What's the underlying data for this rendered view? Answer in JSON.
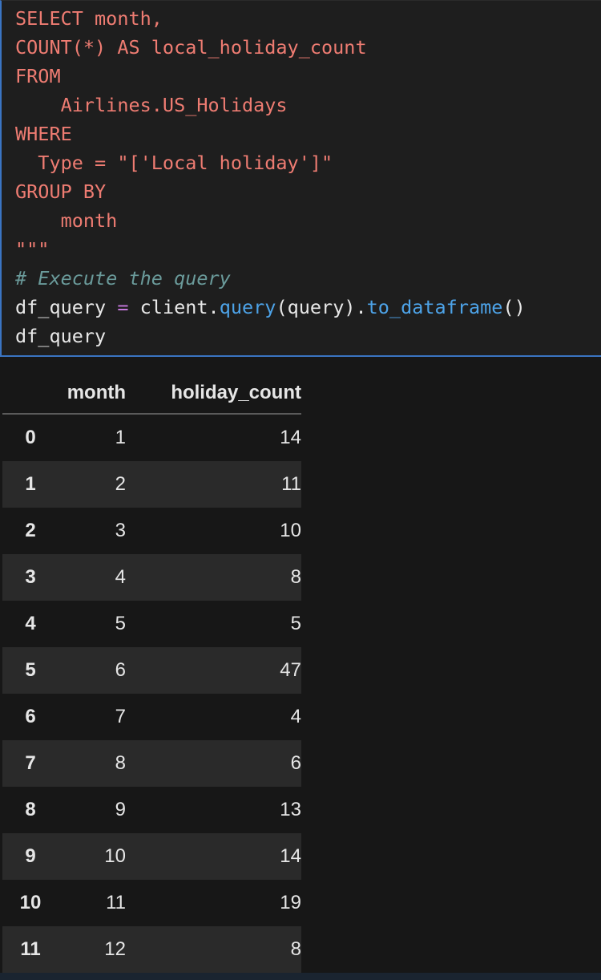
{
  "code": {
    "lines": [
      "SELECT month,",
      "COUNT(*) AS local_holiday_count",
      "FROM",
      "    Airlines.US_Holidays",
      "WHERE",
      "  Type = \"['Local holiday']\"",
      "GROUP BY",
      "    month",
      "\"\"\"",
      "# Execute the query",
      "df_query = client.query(query).to_dataframe()",
      "df_query"
    ],
    "tokens": {
      "df_query": "df_query",
      "eq": "=",
      "client": "client.",
      "query_fn": "query",
      "query_arg": "(query).",
      "to_dataframe": "to_dataframe",
      "parens": "()"
    }
  },
  "table": {
    "columns": [
      "",
      "month",
      "holiday_count"
    ],
    "rows": [
      {
        "index": "0",
        "month": "1",
        "holiday_count": "14"
      },
      {
        "index": "1",
        "month": "2",
        "holiday_count": "11"
      },
      {
        "index": "2",
        "month": "3",
        "holiday_count": "10"
      },
      {
        "index": "3",
        "month": "4",
        "holiday_count": "8"
      },
      {
        "index": "4",
        "month": "5",
        "holiday_count": "5"
      },
      {
        "index": "5",
        "month": "6",
        "holiday_count": "47"
      },
      {
        "index": "6",
        "month": "7",
        "holiday_count": "4"
      },
      {
        "index": "7",
        "month": "8",
        "holiday_count": "6"
      },
      {
        "index": "8",
        "month": "9",
        "holiday_count": "13"
      },
      {
        "index": "9",
        "month": "10",
        "holiday_count": "14"
      },
      {
        "index": "10",
        "month": "11",
        "holiday_count": "19"
      },
      {
        "index": "11",
        "month": "12",
        "holiday_count": "8"
      }
    ]
  },
  "colors": {
    "string": "#ee7c72",
    "comment": "#6a9a9a",
    "function": "#4da3e8",
    "operator": "#c678dd",
    "cell_border": "#3a74c2"
  }
}
